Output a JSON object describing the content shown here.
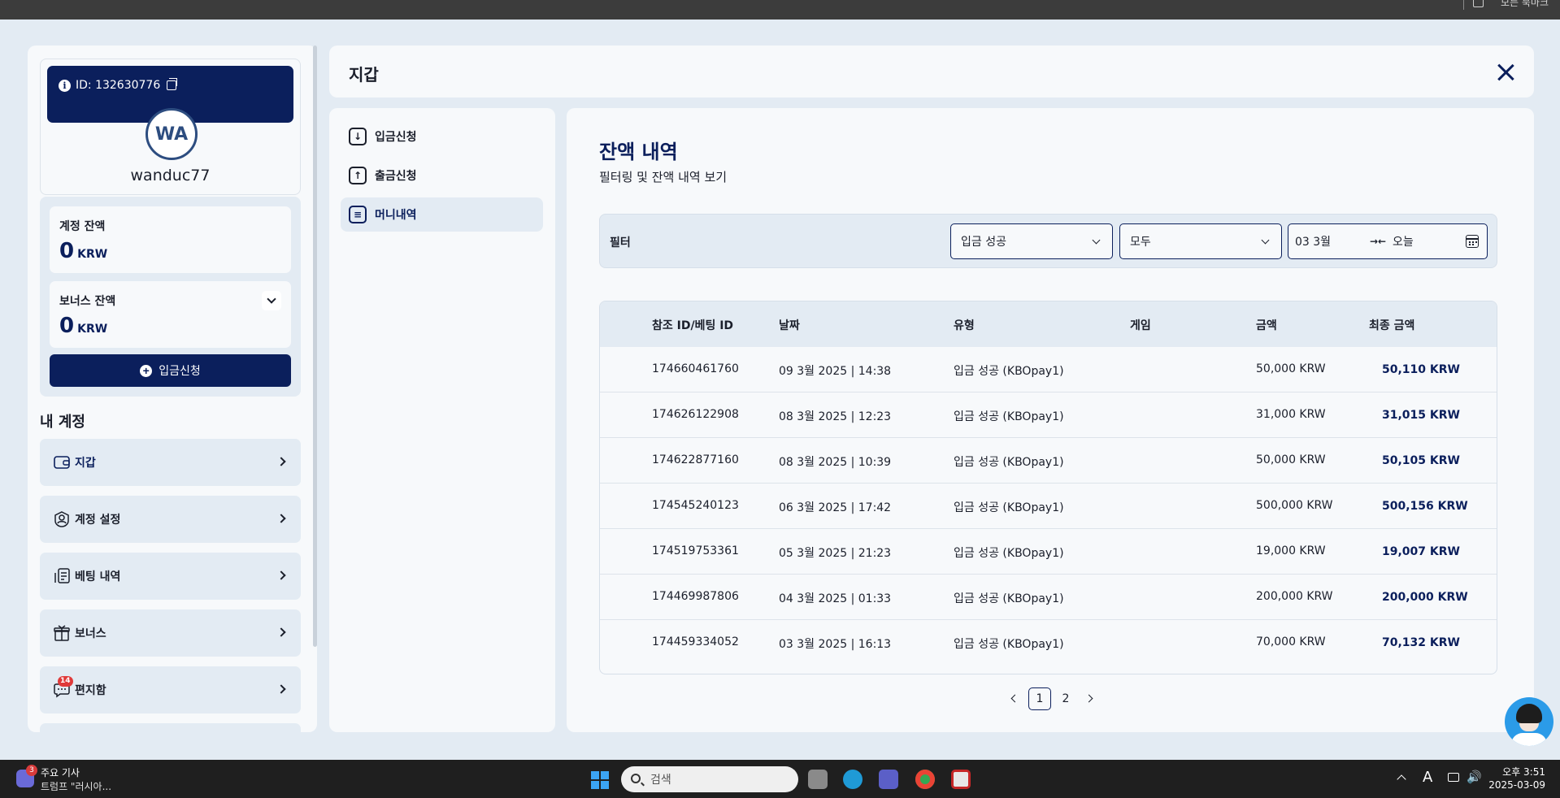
{
  "browser": {
    "bookmarks_label": "모든 북마크"
  },
  "profile": {
    "id_label": "ID: 132630776",
    "initials": "WA",
    "username": "wanduc77"
  },
  "balances": {
    "account": {
      "title": "계정 잔액",
      "value": "0",
      "currency": "KRW"
    },
    "bonus": {
      "title": "보너스 잔액",
      "value": "0",
      "currency": "KRW"
    },
    "deposit_button": "입금신청"
  },
  "my_account": {
    "title": "내 계정",
    "items": [
      {
        "label": "지갑",
        "icon": "wallet-icon"
      },
      {
        "label": "계정 설정",
        "icon": "user-settings-icon"
      },
      {
        "label": "베팅 내역",
        "icon": "receipt-icon"
      },
      {
        "label": "보너스",
        "icon": "gift-icon"
      },
      {
        "label": "편지함",
        "icon": "message-icon",
        "badge": "14"
      }
    ]
  },
  "header": {
    "title": "지갑"
  },
  "sub_nav": [
    {
      "label": "입금신청",
      "icon": "download-icon"
    },
    {
      "label": "출금신청",
      "icon": "upload-icon"
    },
    {
      "label": "머니내역",
      "icon": "document-icon"
    }
  ],
  "main": {
    "title": "잔액 내역",
    "subtitle": "필터링 및 잔액 내역 보기",
    "filter": {
      "label": "필터",
      "status_select": "입금 성공",
      "type_select": "모두",
      "date_from": "03 3월",
      "range_arrow": "→←",
      "date_to": "오늘"
    },
    "table": {
      "headers": [
        "참조 ID/베팅 ID",
        "날짜",
        "유형",
        "게임",
        "금액",
        "최종 금액"
      ],
      "rows": [
        {
          "ref": "174660461760",
          "date": "09 3월 2025 | 14:38",
          "type": "입금 성공 (KBOpay1)",
          "game": "",
          "amount": "50,000 KRW",
          "final": "50,110 KRW"
        },
        {
          "ref": "174626122908",
          "date": "08 3월 2025 | 12:23",
          "type": "입금 성공 (KBOpay1)",
          "game": "",
          "amount": "31,000 KRW",
          "final": "31,015 KRW"
        },
        {
          "ref": "174622877160",
          "date": "08 3월 2025 | 10:39",
          "type": "입금 성공 (KBOpay1)",
          "game": "",
          "amount": "50,000 KRW",
          "final": "50,105 KRW"
        },
        {
          "ref": "174545240123",
          "date": "06 3월 2025 | 17:42",
          "type": "입금 성공 (KBOpay1)",
          "game": "",
          "amount": "500,000 KRW",
          "final": "500,156 KRW"
        },
        {
          "ref": "174519753361",
          "date": "05 3월 2025 | 21:23",
          "type": "입금 성공 (KBOpay1)",
          "game": "",
          "amount": "19,000 KRW",
          "final": "19,007 KRW"
        },
        {
          "ref": "174469987806",
          "date": "04 3월 2025 | 01:33",
          "type": "입금 성공 (KBOpay1)",
          "game": "",
          "amount": "200,000 KRW",
          "final": "200,000 KRW"
        },
        {
          "ref": "174459334052",
          "date": "03 3월 2025 | 16:13",
          "type": "입금 성공 (KBOpay1)",
          "game": "",
          "amount": "70,000 KRW",
          "final": "70,132 KRW"
        }
      ]
    },
    "pagination": {
      "pages": [
        "1",
        "2"
      ],
      "current": "1"
    }
  },
  "taskbar": {
    "news_badge": "3",
    "news_title": "주요 기사",
    "news_sub": "트럼프 \"러시아...",
    "search_placeholder": "검색",
    "tray_language": "A",
    "clock_time": "오후 3:51",
    "clock_date": "2025-03-09"
  },
  "colors": {
    "navy": "#0b1f5c",
    "panel": "#f7f9fb",
    "background": "#e3ebf3"
  }
}
